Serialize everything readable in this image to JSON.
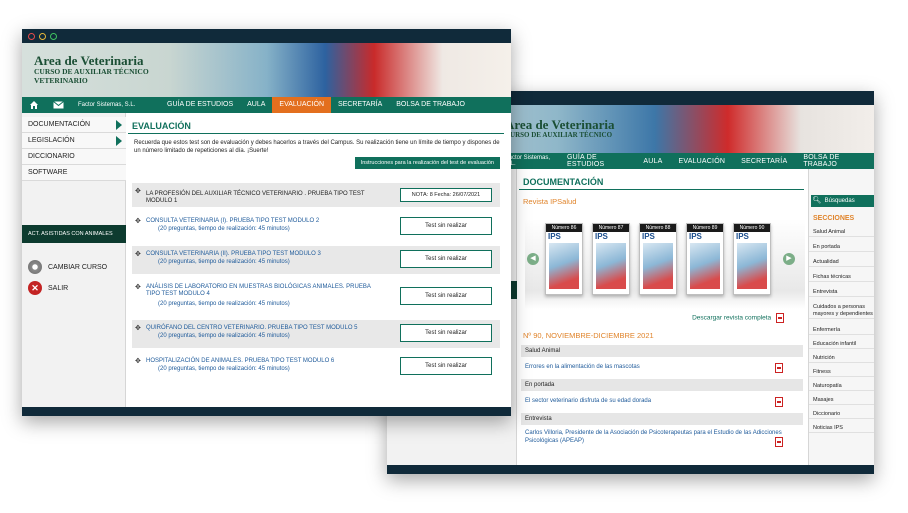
{
  "back_window": {
    "banner_title": "Area de Veterinaria",
    "banner_subtitle": "CURSO DE AUXILIAR TÉCNICO",
    "nav": {
      "company": "Factor Sistemas, S.L.",
      "items": [
        "GUÍA DE ESTUDIOS",
        "AULA",
        "EVALUACIÓN",
        "SECRETARÍA",
        "BOLSA DE TRABAJO"
      ]
    },
    "section_title": "DOCUMENTACIÓN",
    "revista_label": "Revista IPSalud",
    "magazines": [
      {
        "number": "Número 86",
        "brand": "IPS"
      },
      {
        "number": "Número 87",
        "brand": "IPS"
      },
      {
        "number": "Número 88",
        "brand": "IPS"
      },
      {
        "number": "Número 89",
        "brand": "IPS"
      },
      {
        "number": "Número 90",
        "brand": "IPS"
      }
    ],
    "download_label": "Descargar revista completa",
    "issue_label": "Nº 90, NOVIEMBRE-DICIEMBRE 2021",
    "categories": [
      {
        "name": "Salud Animal",
        "article": "Errores en la alimentación de las mascotas"
      },
      {
        "name": "En portada",
        "article": "El sector veterinario disfruta de su edad dorada"
      },
      {
        "name": "Entrevista",
        "article": "Carlos Villoria, Presidente de la Asociación de Psicoterapeutas para el Estudio de las Adicciones Psicológicas (APEAP)"
      }
    ],
    "search_label": "Búsquedas",
    "sections_heading": "SECCIONES",
    "sections": [
      "Salud Animal",
      "En portada",
      "Actualidad",
      "Fichas técnicas",
      "Entrevista",
      "Cuidados a personas mayores y dependientes",
      "Enfermería",
      "Educación infantil",
      "Nutrición",
      "Fitness",
      "Naturopatía",
      "Masajes",
      "Diccionario",
      "Noticias IPS"
    ]
  },
  "front_window": {
    "banner_title": "Area de Veterinaria",
    "banner_sub1": "CURSO DE AUXILIAR TÉCNICO",
    "banner_sub2": "VETERINARIO",
    "nav": {
      "company": "Factor Sistemas, S.L.",
      "items": [
        "GUÍA DE ESTUDIOS",
        "AULA",
        "EVALUACIÓN",
        "SECRETARÍA",
        "BOLSA DE TRABAJO"
      ],
      "active": "EVALUACIÓN"
    },
    "sidebar": {
      "items": [
        "DOCUMENTACIÓN",
        "LEGISLACIÓN",
        "DICCIONARIO",
        "SOFTWARE"
      ],
      "act_label": "ACT. ASISTIDAS CON ANIMALES",
      "cambiar_curso": "CAMBIAR CURSO",
      "salir": "SALIR"
    },
    "section_title": "EVALUACIÓN",
    "intro": "Recuerda que estos test son de evaluación y debes hacerlos a través del Campus. Su realización tiene un límite de tiempo y dispones de un número limitado de repeticiones al día. ¡Suerte!",
    "instructions_button": "Instrucciones para la realización del test de evaluación",
    "tests": [
      {
        "title": "LA PROFESIÓN DEL AUXILIAR TÉCNICO VETERINARIO . PRUEBA TIPO TEST MODULO 1",
        "sub": "",
        "status": "NOTA: 8  Fecha: 26/07/2021"
      },
      {
        "title": "CONSULTA VETERINARIA (I). PRUEBA TIPO TEST MODULO 2",
        "sub": "(20 preguntas, tiempo de realización: 45 minutos)",
        "status": "Test sin realizar"
      },
      {
        "title": "CONSULTA VETERINARIA (II). PRUEBA TIPO TEST MODULO 3",
        "sub": "(20 preguntas, tiempo de realización: 45 minutos)",
        "status": "Test sin realizar"
      },
      {
        "title": "ANÁLISIS DE LABORATORIO EN MUESTRAS BIOLÓGICAS ANIMALES. PRUEBA TIPO TEST MODULO 4",
        "sub": "(20 preguntas, tiempo de realización: 45 minutos)",
        "status": "Test sin realizar"
      },
      {
        "title": "QUIRÓFANO DEL CENTRO VETERINARIO. PRUEBA TIPO TEST MODULO 5",
        "sub": "(20 preguntas, tiempo de realización: 45 minutos)",
        "status": "Test sin realizar"
      },
      {
        "title": "HOSPITALIZACIÓN DE ANIMALES. PRUEBA TIPO TEST MODULO 6",
        "sub": "(20 preguntas, tiempo de realización: 45 minutos)",
        "status": "Test sin realizar"
      }
    ]
  }
}
